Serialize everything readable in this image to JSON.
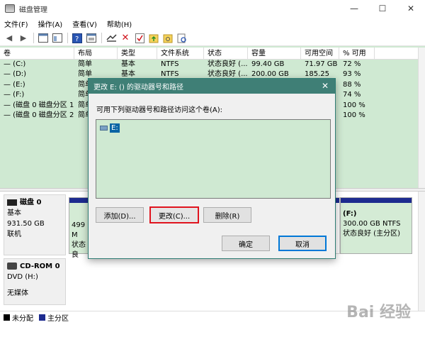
{
  "window": {
    "title": "磁盘管理",
    "controls": [
      "—",
      "☐",
      "✕"
    ]
  },
  "menu": [
    "文件(F)",
    "操作(A)",
    "查看(V)",
    "帮助(H)"
  ],
  "toolbar": {
    "icons": [
      "back-arrow",
      "forward-arrow",
      "properties",
      "view-pane",
      "help",
      "console",
      "connect",
      "delete",
      "check",
      "folder-up",
      "find-folder",
      "search"
    ]
  },
  "volumes": {
    "headers": [
      "卷",
      "布局",
      "类型",
      "文件系统",
      "状态",
      "容量",
      "可用空间",
      "% 可用"
    ],
    "rows": [
      [
        "— (C:)",
        "简单",
        "基本",
        "NTFS",
        "状态良好 (...",
        "99.40 GB",
        "71.97 GB",
        "72 %"
      ],
      [
        "— (D:)",
        "简单",
        "基本",
        "NTFS",
        "状态良好 (...",
        "200.00 GB",
        "185.25",
        "93 %"
      ],
      [
        "— (E:)",
        "简单",
        "",
        "",
        "",
        "",
        "",
        "88 %"
      ],
      [
        "— (F:)",
        "简单",
        "",
        "",
        "",
        "",
        "",
        "74 %"
      ],
      [
        "— (磁盘 0 磁盘分区 1)",
        "简单",
        "",
        "",
        "",
        "",
        "",
        "100 %"
      ],
      [
        "— (磁盘 0 磁盘分区 2)",
        "简单",
        "",
        "",
        "",
        "",
        "",
        "100 %"
      ]
    ]
  },
  "disks": {
    "disk0": {
      "name": "磁盘 0",
      "type": "基本",
      "size": "931.50 GB",
      "status": "联机",
      "part_left_size": "499 M",
      "part_left_status": "状态良",
      "part_f_name": "(F:)",
      "part_f_size": "300.00 GB NTFS",
      "part_f_status": "状态良好 (主分区)"
    },
    "cdrom0": {
      "name": "CD-ROM 0",
      "drive": "DVD (H:)",
      "status": "无媒体"
    }
  },
  "legend": {
    "unallocated": "未分配",
    "primary": "主分区",
    "colors": {
      "unallocated": "#000000",
      "primary": "#1d2b8f"
    }
  },
  "dialog": {
    "title": "更改 E: () 的驱动器号和路径",
    "close": "✕",
    "prompt": "可用下列驱动器号和路径访问这个卷(A):",
    "paths": [
      "E:"
    ],
    "buttons": {
      "add": "添加(D)...",
      "change": "更改(C)...",
      "remove": "删除(R)",
      "ok": "确定",
      "cancel": "取消"
    }
  },
  "watermark": "Bai 经验",
  "colors": {
    "accent": "#3f7f76",
    "volume_bg": "#cfe9d2",
    "highlight": "#e0141e",
    "selection": "#0a64a4"
  }
}
